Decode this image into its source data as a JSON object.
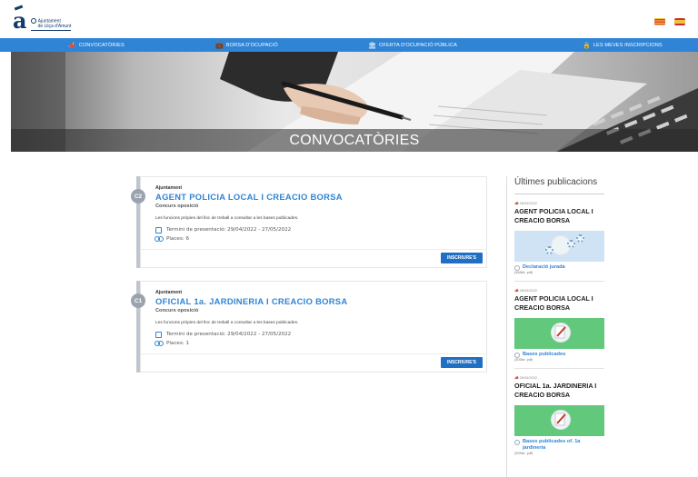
{
  "header": {
    "logo_line1": "Ajuntament",
    "logo_line2": "de Lliça d'Amunt",
    "languages": [
      "ca",
      "es"
    ]
  },
  "nav": {
    "items": [
      {
        "label": "CONVOCATÒRIES",
        "icon": "megaphone-icon"
      },
      {
        "label": "BORSA D'OCUPACIÓ",
        "icon": "briefcase-icon"
      },
      {
        "label": "OFERTA D'OCUPACIÓ PÚBLICA",
        "icon": "bank-icon"
      },
      {
        "label": "LES MEVES INSCRIPCIONS",
        "icon": "lock-icon"
      }
    ],
    "color": "#2f84d6"
  },
  "hero": {
    "title": "CONVOCATÒRIES"
  },
  "convocatories": [
    {
      "badge": "C2",
      "kicker": "Ajuntament",
      "title": "AGENT POLICIA LOCAL I CREACIO BORSA",
      "type": "Concurs oposició",
      "description": "Les funcions pròpies del lloc de treball a consultar a les bases publicades.",
      "period_label": "Termini de presentació:",
      "period": "29/04/2022 - 27/05/2022",
      "places_label": "Places:",
      "places": "6",
      "button": "INSCRIURE'S"
    },
    {
      "badge": "C1",
      "kicker": "Ajuntament",
      "title": "OFICIAL 1a. JARDINERIA I CREACIO BORSA",
      "type": "Concurs oposició",
      "description": "Les funcions pròpies del lloc de treball a consultar a les bases publicades.",
      "period_label": "Termini de presentació:",
      "period": "29/04/2022 - 27/05/2022",
      "places_label": "Places:",
      "places": "1",
      "button": "INSCRIURE'S"
    }
  ],
  "sidebar": {
    "title": "Últimes publicacions",
    "publications": [
      {
        "date": "26/04/2022",
        "title": "AGENT POLICIA LOCAL I CREACIO BORSA",
        "file_label": "Declaració jurada",
        "file_size": "(458kb. pdf)",
        "thumb": "blue"
      },
      {
        "date": "26/04/2022",
        "title": "AGENT POLICIA LOCAL I CREACIO BORSA",
        "file_label": "Bases publicades",
        "file_size": "(305kb. pdf)",
        "thumb": "green"
      },
      {
        "date": "26/04/2022",
        "title": "OFICIAL 1a. JARDINERIA I CREACIO BORSA",
        "file_label": "Bases publicades of. 1a jardineria",
        "file_size": "(305kb. pdf)",
        "thumb": "green"
      }
    ]
  }
}
